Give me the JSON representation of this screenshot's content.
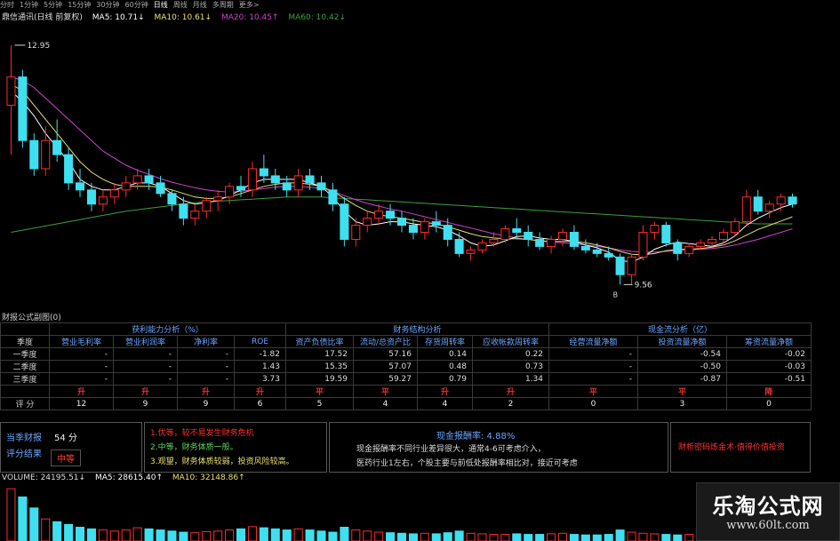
{
  "toolbar": {
    "items": [
      "分时",
      "1分钟",
      "5分钟",
      "15分钟",
      "30分钟",
      "60分钟",
      "日线",
      "周线",
      "月线",
      "多周期",
      "更多>"
    ]
  },
  "ma_row": {
    "title": "鼎信通讯(日线 前复权)",
    "ma5": "MA5: 10.71↓",
    "ma10": "MA10: 10.61↓",
    "ma20": "MA20: 10.45↑",
    "ma60": "MA60: 10.42↓"
  },
  "chart_data": {
    "type": "candlestick",
    "high_label": "12.95",
    "low_label": "9.56",
    "low_marker": "B",
    "ylim": [
      9.3,
      13.2
    ],
    "colors": {
      "up": "#ff2b2b",
      "down": "#3ee0f0",
      "ma5": "#ffffff",
      "ma10": "#e8e070",
      "ma20": "#d040d0",
      "ma60": "#3ca03c"
    },
    "candles": [
      [
        12.1,
        12.95,
        11.4,
        12.5
      ],
      [
        12.5,
        12.6,
        11.5,
        11.6
      ],
      [
        11.6,
        11.7,
        11.1,
        11.2
      ],
      [
        11.2,
        11.8,
        11.1,
        11.6
      ],
      [
        11.6,
        11.9,
        11.3,
        11.4
      ],
      [
        11.4,
        11.5,
        10.9,
        11.0
      ],
      [
        11.0,
        11.2,
        10.8,
        10.9
      ],
      [
        10.9,
        11.0,
        10.6,
        10.7
      ],
      [
        10.7,
        10.9,
        10.6,
        10.8
      ],
      [
        10.8,
        11.0,
        10.7,
        10.9
      ],
      [
        10.9,
        11.1,
        10.8,
        11.0
      ],
      [
        11.0,
        11.2,
        10.9,
        11.1
      ],
      [
        11.1,
        11.2,
        10.9,
        11.0
      ],
      [
        11.0,
        11.1,
        10.8,
        10.85
      ],
      [
        10.85,
        10.9,
        10.6,
        10.7
      ],
      [
        10.7,
        10.8,
        10.4,
        10.5
      ],
      [
        10.5,
        10.7,
        10.4,
        10.6
      ],
      [
        10.6,
        10.8,
        10.5,
        10.75
      ],
      [
        10.75,
        10.9,
        10.6,
        10.8
      ],
      [
        10.8,
        11.0,
        10.7,
        10.95
      ],
      [
        10.95,
        11.1,
        10.8,
        10.9
      ],
      [
        10.9,
        11.3,
        10.8,
        11.2
      ],
      [
        11.2,
        11.4,
        11.0,
        11.1
      ],
      [
        11.1,
        11.2,
        10.9,
        11.0
      ],
      [
        11.0,
        11.1,
        10.8,
        10.9
      ],
      [
        10.9,
        11.2,
        10.8,
        11.1
      ],
      [
        11.1,
        11.2,
        10.9,
        11.0
      ],
      [
        11.0,
        11.1,
        10.8,
        10.9
      ],
      [
        10.9,
        11.0,
        10.6,
        10.7
      ],
      [
        10.7,
        10.8,
        10.1,
        10.2
      ],
      [
        10.2,
        10.5,
        10.1,
        10.4
      ],
      [
        10.4,
        10.6,
        10.3,
        10.5
      ],
      [
        10.5,
        10.7,
        10.4,
        10.6
      ],
      [
        10.6,
        10.7,
        10.4,
        10.5
      ],
      [
        10.5,
        10.6,
        10.3,
        10.4
      ],
      [
        10.4,
        10.5,
        10.2,
        10.3
      ],
      [
        10.3,
        10.5,
        10.2,
        10.45
      ],
      [
        10.45,
        10.6,
        10.3,
        10.4
      ],
      [
        10.4,
        10.5,
        10.1,
        10.2
      ],
      [
        10.2,
        10.3,
        9.95,
        10.0
      ],
      [
        10.0,
        10.1,
        9.9,
        10.05
      ],
      [
        10.05,
        10.2,
        10.0,
        10.15
      ],
      [
        10.15,
        10.3,
        10.1,
        10.2
      ],
      [
        10.2,
        10.4,
        10.15,
        10.35
      ],
      [
        10.35,
        10.5,
        10.2,
        10.3
      ],
      [
        10.3,
        10.4,
        10.1,
        10.2
      ],
      [
        10.2,
        10.3,
        10.05,
        10.1
      ],
      [
        10.1,
        10.25,
        10.0,
        10.2
      ],
      [
        10.2,
        10.35,
        10.1,
        10.3
      ],
      [
        10.3,
        10.4,
        10.05,
        10.1
      ],
      [
        10.1,
        10.2,
        10.0,
        10.05
      ],
      [
        10.05,
        10.15,
        9.95,
        10.0
      ],
      [
        10.0,
        10.1,
        9.9,
        9.95
      ],
      [
        9.95,
        10.0,
        9.56,
        9.7
      ],
      [
        9.7,
        10.0,
        9.56,
        9.95
      ],
      [
        9.95,
        10.4,
        9.9,
        10.3
      ],
      [
        10.3,
        10.45,
        10.2,
        10.4
      ],
      [
        10.4,
        10.45,
        10.1,
        10.15
      ],
      [
        10.15,
        10.2,
        9.9,
        10.0
      ],
      [
        10.0,
        10.15,
        9.95,
        10.1
      ],
      [
        10.1,
        10.2,
        10.05,
        10.15
      ],
      [
        10.15,
        10.25,
        10.1,
        10.2
      ],
      [
        10.2,
        10.35,
        10.15,
        10.3
      ],
      [
        10.3,
        10.5,
        10.25,
        10.45
      ],
      [
        10.45,
        10.9,
        10.4,
        10.8
      ],
      [
        10.8,
        10.9,
        10.55,
        10.6
      ],
      [
        10.6,
        10.75,
        10.5,
        10.7
      ],
      [
        10.7,
        10.85,
        10.6,
        10.8
      ],
      [
        10.8,
        10.85,
        10.65,
        10.7
      ]
    ],
    "ma5": [
      12.3,
      12.15,
      11.95,
      11.7,
      11.5,
      11.3,
      11.05,
      10.95,
      10.9,
      10.9,
      10.95,
      11.0,
      11.0,
      10.95,
      10.85,
      10.75,
      10.7,
      10.72,
      10.75,
      10.82,
      10.9,
      11.0,
      11.05,
      11.05,
      11.05,
      11.05,
      11.0,
      10.95,
      10.8,
      10.6,
      10.45,
      10.4,
      10.42,
      10.45,
      10.45,
      10.42,
      10.4,
      10.38,
      10.33,
      10.25,
      10.15,
      10.1,
      10.12,
      10.18,
      10.24,
      10.25,
      10.22,
      10.2,
      10.2,
      10.17,
      10.12,
      10.08,
      10.02,
      9.9,
      9.88,
      9.95,
      10.06,
      10.12,
      10.16,
      10.14,
      10.12,
      10.1,
      10.15,
      10.25,
      10.4,
      10.5,
      10.58,
      10.65,
      10.7
    ],
    "ma10": [
      12.4,
      12.3,
      12.1,
      11.9,
      11.7,
      11.5,
      11.3,
      11.15,
      11.05,
      10.98,
      10.95,
      10.95,
      10.95,
      10.94,
      10.9,
      10.85,
      10.8,
      10.78,
      10.78,
      10.8,
      10.85,
      10.9,
      10.95,
      10.98,
      11.0,
      11.0,
      10.98,
      10.95,
      10.88,
      10.78,
      10.68,
      10.6,
      10.55,
      10.52,
      10.5,
      10.47,
      10.44,
      10.42,
      10.38,
      10.33,
      10.28,
      10.24,
      10.22,
      10.21,
      10.21,
      10.2,
      10.18,
      10.17,
      10.17,
      10.17,
      10.15,
      10.12,
      10.08,
      10.03,
      9.99,
      9.98,
      10.0,
      10.04,
      10.06,
      10.06,
      10.07,
      10.09,
      10.12,
      10.18,
      10.26,
      10.34,
      10.4,
      10.46,
      10.52
    ],
    "ma20": [
      12.5,
      12.45,
      12.35,
      12.2,
      12.05,
      11.9,
      11.75,
      11.6,
      11.45,
      11.35,
      11.25,
      11.18,
      11.12,
      11.06,
      11.01,
      10.97,
      10.93,
      10.9,
      10.88,
      10.87,
      10.88,
      10.9,
      10.92,
      10.94,
      10.95,
      10.95,
      10.94,
      10.92,
      10.88,
      10.82,
      10.76,
      10.71,
      10.67,
      10.63,
      10.6,
      10.56,
      10.52,
      10.48,
      10.44,
      10.4,
      10.36,
      10.32,
      10.28,
      10.25,
      10.22,
      10.2,
      10.18,
      10.16,
      10.15,
      10.14,
      10.12,
      10.1,
      10.08,
      10.05,
      10.03,
      10.02,
      10.02,
      10.03,
      10.04,
      10.05,
      10.06,
      10.07,
      10.09,
      10.12,
      10.16,
      10.2,
      10.25,
      10.3,
      10.35
    ],
    "ma60": [
      10.3,
      10.33,
      10.36,
      10.39,
      10.42,
      10.45,
      10.48,
      10.51,
      10.54,
      10.57,
      10.6,
      10.62,
      10.64,
      10.66,
      10.68,
      10.7,
      10.72,
      10.73,
      10.74,
      10.75,
      10.76,
      10.77,
      10.78,
      10.79,
      10.8,
      10.8,
      10.8,
      10.8,
      10.79,
      10.78,
      10.77,
      10.76,
      10.75,
      10.74,
      10.73,
      10.72,
      10.71,
      10.7,
      10.69,
      10.68,
      10.67,
      10.66,
      10.65,
      10.64,
      10.63,
      10.62,
      10.61,
      10.6,
      10.59,
      10.58,
      10.57,
      10.56,
      10.55,
      10.54,
      10.53,
      10.52,
      10.51,
      10.5,
      10.49,
      10.48,
      10.47,
      10.46,
      10.45,
      10.44,
      10.43,
      10.42,
      10.42,
      10.42,
      10.42
    ]
  },
  "volume": {
    "title": "VOLUME: 24195.51↓",
    "ma5": "MA5: 28615.40↑",
    "ma10": "MA10: 32148.86↑",
    "bars": [
      95,
      80,
      60,
      40,
      35,
      30,
      25,
      22,
      20,
      18,
      20,
      24,
      22,
      20,
      18,
      16,
      15,
      17,
      18,
      20,
      22,
      26,
      24,
      22,
      20,
      22,
      20,
      18,
      16,
      25,
      20,
      18,
      16,
      15,
      14,
      13,
      14,
      13,
      15,
      18,
      14,
      13,
      12,
      12,
      13,
      12,
      12,
      13,
      14,
      12,
      11,
      11,
      12,
      20,
      16,
      14,
      13,
      12,
      11,
      12,
      12,
      13,
      14,
      16,
      20,
      15,
      14,
      15,
      14
    ],
    "ylim": [
      0,
      100
    ]
  },
  "panel": {
    "title": "财报公式副图(0)"
  },
  "table": {
    "group_headers": [
      "获利能力分析（%）",
      "财务结构分析",
      "现金流分析（亿）"
    ],
    "row_header_label": "季度",
    "columns": [
      "营业毛利率",
      "营业利润率",
      "净利率",
      "ROE",
      "资产负债比率",
      "流动/总资产比",
      "存货周转率",
      "应收帐款周转率",
      "经营流量净额",
      "投资流量净额",
      "筹资流量净额"
    ],
    "rows": [
      {
        "label": "一季度",
        "cells": [
          "-",
          "-",
          "-",
          "-1.82",
          "17.52",
          "57.16",
          "0.14",
          "0.22",
          "-",
          "-0.54",
          "-0.02"
        ]
      },
      {
        "label": "二季度",
        "cells": [
          "-",
          "-",
          "-",
          "1.43",
          "15.35",
          "57.07",
          "0.48",
          "0.73",
          "-",
          "-0.50",
          "-0.03"
        ]
      },
      {
        "label": "三季度",
        "cells": [
          "-",
          "-",
          "-",
          "3.73",
          "19.59",
          "59.27",
          "0.79",
          "1.34",
          "-",
          "-0.87",
          "-0.51"
        ]
      }
    ],
    "trend_row": [
      "升",
      "升",
      "升",
      "升",
      "平",
      "平",
      "升",
      "升",
      "平",
      "平",
      "降"
    ],
    "score_label": "评 分",
    "scores": [
      "12",
      "9",
      "9",
      "6",
      "5",
      "4",
      "4",
      "2",
      "0",
      "3",
      "0"
    ]
  },
  "summary": {
    "total_label": "当季财报",
    "total_score": "54 分",
    "result_label": "评分结果",
    "result_value": "中等",
    "notes": [
      "1.优等，较不易发生财务危机",
      "2.中等，财务体质一般。",
      "3.观望，财务体质较弱，投资风险较高。"
    ],
    "cash_title": "现金报酬率: 4.88%",
    "cash_lines": [
      "现金报酬率不同行业差异很大，通常4-6可考虑介入，",
      "医药行业1左右，个股主要与前低处报酬率相比对，接近可考虑"
    ],
    "promo": "财析密码炼金术·值得价值投资"
  },
  "watermark": {
    "title": "乐淘公式网",
    "url": "www.60lt.com"
  }
}
